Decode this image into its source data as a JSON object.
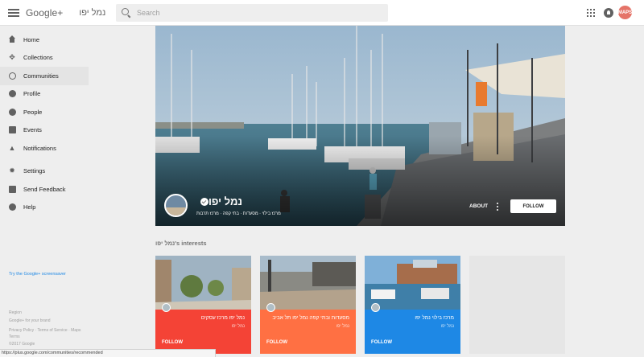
{
  "header": {
    "product": "Google+",
    "context": "נמל יפו",
    "search_placeholder": "Search",
    "account_initials": "MAPS"
  },
  "sidebar": {
    "items": [
      {
        "label": "Home",
        "icon": "home-icon"
      },
      {
        "label": "Collections",
        "icon": "collections-icon"
      },
      {
        "label": "Communities",
        "icon": "communities-icon",
        "active": true
      },
      {
        "label": "Profile",
        "icon": "profile-icon"
      },
      {
        "label": "People",
        "icon": "people-icon"
      },
      {
        "label": "Events",
        "icon": "events-icon"
      },
      {
        "label": "Notifications",
        "icon": "notifications-icon"
      }
    ],
    "secondary": [
      {
        "label": "Settings",
        "icon": "settings-icon"
      },
      {
        "label": "Send Feedback",
        "icon": "feedback-icon"
      },
      {
        "label": "Help",
        "icon": "help-icon"
      }
    ],
    "screensaver": "Try the Google+ screensaver",
    "footer": {
      "region": "Region",
      "brand": "Google+ for your brand",
      "policy": "Privacy Policy · Terms of Service · Maps Terms",
      "copyright": "©2017 Google"
    }
  },
  "community": {
    "name": "נמל יפו",
    "tags": "מרכז בילוי · מסעדות · בתי קפה · מרכז תרבות",
    "about": "ABOUT",
    "follow": "FOLLOW"
  },
  "interests": {
    "title": "נמל יפו's interests",
    "cards": [
      {
        "title": "נמל יפו מרכז עסקים",
        "subtitle": "נמל יפו",
        "follow": "FOLLOW",
        "color": "#f44336"
      },
      {
        "title": "מסעדות ובתי קפה נמל יפו תל אביב",
        "subtitle": "נמל יפו",
        "follow": "FOLLOW",
        "color": "#ff7043"
      },
      {
        "title": "מרכז בילוי נמל יפו",
        "subtitle": "נמל יפו",
        "follow": "FOLLOW",
        "color": "#1e88e5"
      }
    ]
  },
  "status_url": "https://plus.google.com/communities/recommended"
}
